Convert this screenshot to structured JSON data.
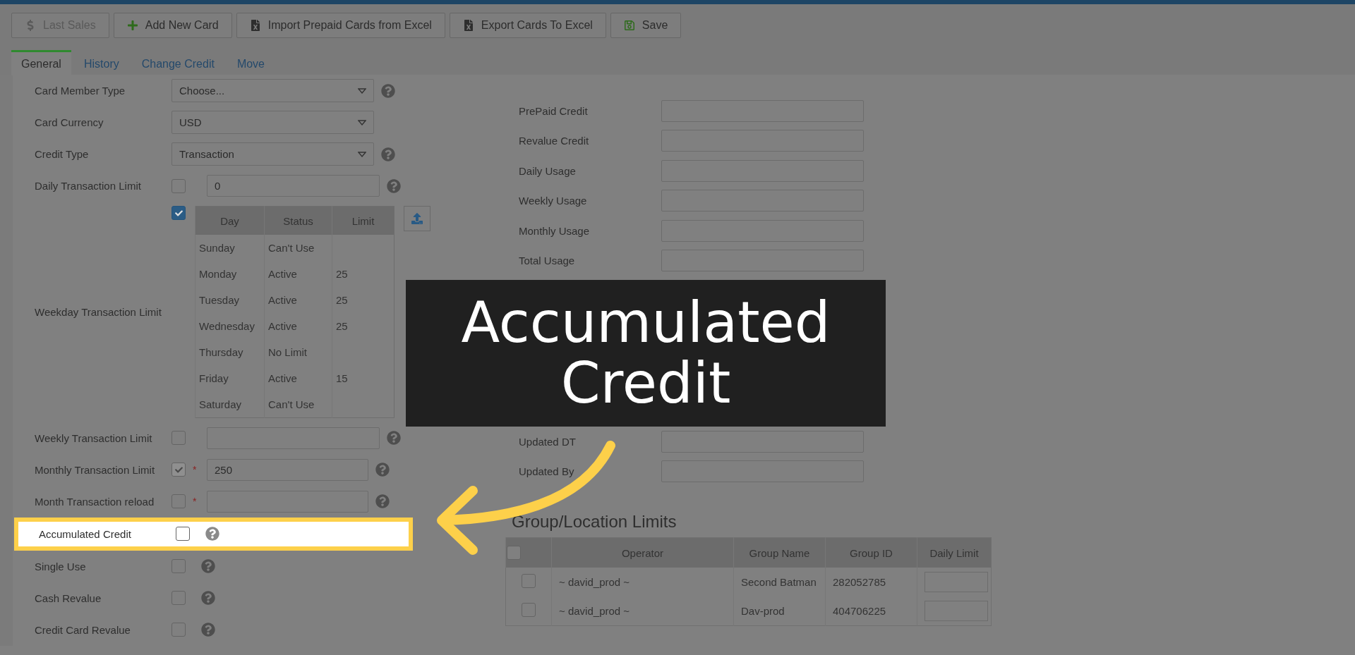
{
  "toolbar": [
    {
      "label": "Last Sales",
      "kind": "dollar",
      "disabled": true
    },
    {
      "label": "Add New Card",
      "kind": "plus",
      "disabled": false
    },
    {
      "label": "Import Prepaid Cards from Excel",
      "kind": "excel",
      "disabled": false
    },
    {
      "label": "Export Cards To Excel",
      "kind": "excel",
      "disabled": false
    },
    {
      "label": "Save",
      "kind": "save",
      "disabled": false
    }
  ],
  "tabs": [
    {
      "label": "General",
      "selected": true
    },
    {
      "label": "History",
      "selected": false
    },
    {
      "label": "Change Credit",
      "selected": false
    },
    {
      "label": "Move",
      "selected": false
    }
  ],
  "form": [
    {
      "label": "Card Member Type",
      "kind": "select",
      "value": "Choose...",
      "help": true,
      "highlighted": false
    },
    {
      "label": "Card Currency",
      "kind": "select",
      "value": "USD",
      "help": false,
      "highlighted": false
    },
    {
      "label": "Credit Type",
      "kind": "select",
      "value": "Transaction",
      "help": true,
      "highlighted": false
    },
    {
      "label": "Daily Transaction Limit",
      "kind": "check_input",
      "checked": false,
      "disabled": false,
      "value": "0",
      "help": true,
      "highlighted": false
    },
    {
      "label": "Weekday Transaction Limit",
      "kind": "weekday_table",
      "checked": true,
      "highlighted": false,
      "columns": [
        "Day",
        "Status",
        "Limit"
      ],
      "rows": [
        {
          "day": "Sunday",
          "status": "Can't Use"
        },
        {
          "day": "Monday",
          "status": "Active",
          "limit": "25"
        },
        {
          "day": "Tuesday",
          "status": "Active",
          "limit": "25"
        },
        {
          "day": "Wednesday",
          "status": "Active",
          "limit": "25"
        },
        {
          "day": "Thursday",
          "status": "No Limit"
        },
        {
          "day": "Friday",
          "status": "Active",
          "limit": "15"
        },
        {
          "day": "Saturday",
          "status": "Can't Use"
        }
      ]
    },
    {
      "label": "Weekly Transaction Limit",
      "kind": "check_input",
      "checked": false,
      "disabled": false,
      "help": true,
      "highlighted": false
    },
    {
      "label": "Monthly Transaction Limit",
      "kind": "check_input",
      "checked": true,
      "disabled": true,
      "required_mark": "*",
      "value": "250",
      "help": true,
      "highlighted": false
    },
    {
      "label": "Month Transaction reload",
      "kind": "check_input",
      "checked": false,
      "disabled": false,
      "required_mark": "*",
      "help": true,
      "highlighted": false
    },
    {
      "label": "Accumulated Credit",
      "kind": "check",
      "checked": false,
      "help": true,
      "highlighted": true
    },
    {
      "label": "Single Use",
      "kind": "check",
      "checked": false,
      "help": true,
      "highlighted": false
    },
    {
      "label": "Cash Revalue",
      "kind": "check",
      "checked": false,
      "help": true,
      "highlighted": false
    },
    {
      "label": "Credit Card Revalue",
      "kind": "check",
      "checked": false,
      "help": true,
      "highlighted": false
    }
  ],
  "usage_fields": [
    {
      "label": "PrePaid Credit"
    },
    {
      "label": "Revalue Credit"
    },
    {
      "label": "Daily Usage"
    },
    {
      "label": "Weekly Usage"
    },
    {
      "label": "Monthly Usage"
    },
    {
      "label": "Total Usage"
    }
  ],
  "misc_fields": [
    {
      "label": "Updated DT"
    },
    {
      "label": "Updated By"
    }
  ],
  "group_limits": {
    "title": "Group/Location Limits",
    "header_checked": false,
    "columns": [
      "Operator",
      "Group Name",
      "Group ID",
      "Daily Limit"
    ],
    "rows": [
      {
        "checked": false,
        "operator": "~ david_prod ~",
        "group_name": "Second Batman",
        "group_id": "282052785"
      },
      {
        "checked": false,
        "operator": "~ david_prod ~",
        "group_name": "Dav-prod",
        "group_id": "404706225"
      }
    ]
  },
  "callout": {
    "text": "Accumulated Credit"
  }
}
